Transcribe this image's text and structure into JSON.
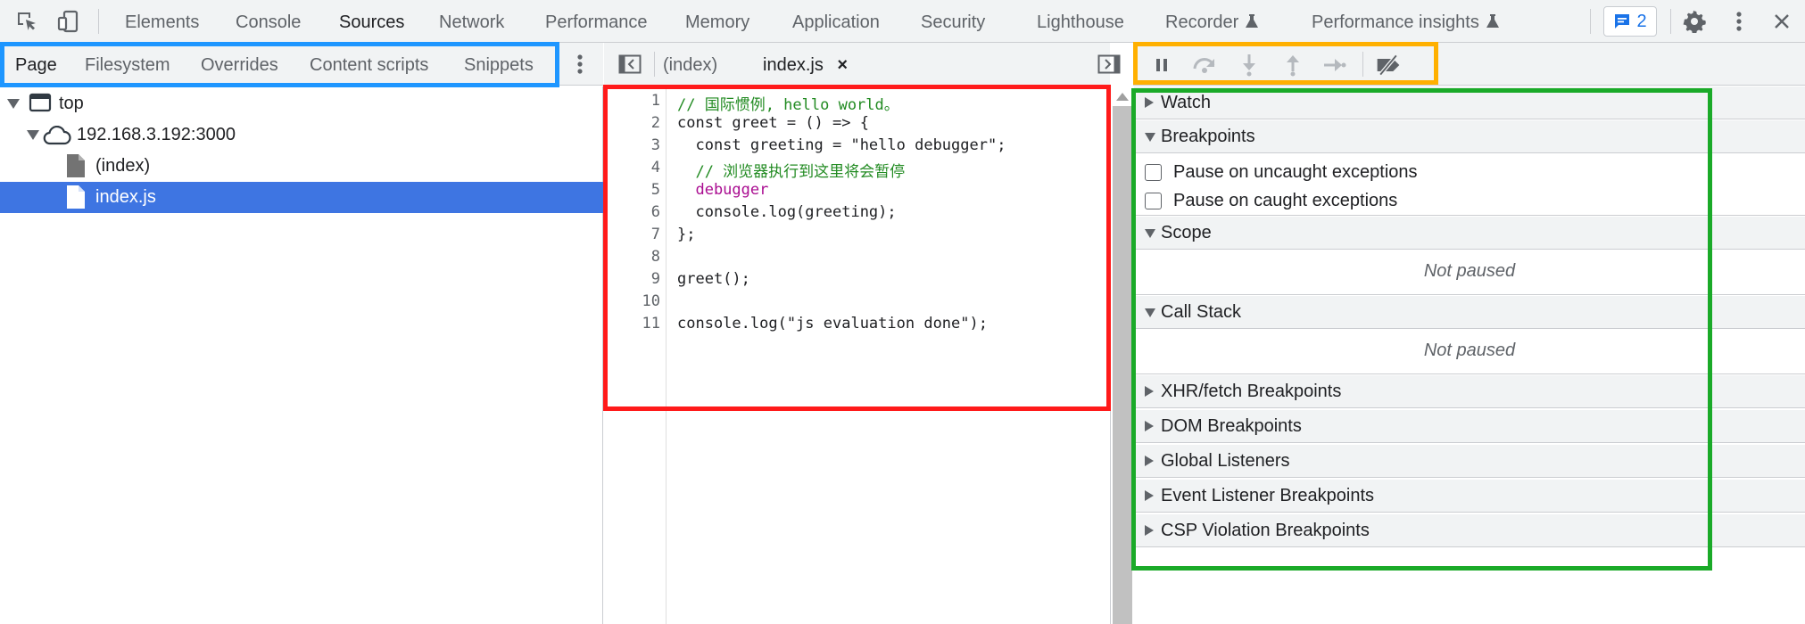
{
  "toolbar": {
    "tabs": [
      "Elements",
      "Console",
      "Sources",
      "Network",
      "Performance",
      "Memory",
      "Application",
      "Security",
      "Lighthouse",
      "Recorder",
      "Performance insights"
    ],
    "active_tab": "Sources",
    "issues_count": "2"
  },
  "navigator": {
    "tabs": [
      "Page",
      "Filesystem",
      "Overrides",
      "Content scripts",
      "Snippets"
    ],
    "active_tab": "Page",
    "tree": [
      {
        "label": "top",
        "icon": "frame-icon",
        "level": 0
      },
      {
        "label": "192.168.3.192:3000",
        "icon": "cloud-icon",
        "level": 1
      },
      {
        "label": "(index)",
        "icon": "file-icon",
        "level": 2
      },
      {
        "label": "index.js",
        "icon": "js-file-icon",
        "level": 2,
        "selected": true
      }
    ]
  },
  "editor": {
    "tabs": [
      "(index)",
      "index.js"
    ],
    "active_tab": "index.js",
    "close_symbol": "×",
    "line_numbers": [
      "1",
      "2",
      "3",
      "4",
      "5",
      "6",
      "7",
      "8",
      "9",
      "10",
      "11"
    ],
    "lines": [
      "// 国际惯例, hello world。",
      "const greet = () => {",
      "  const greeting = \"hello debugger\";",
      "  // 浏览器执行到这里将会暂停",
      "  debugger",
      "  console.log(greeting);",
      "};",
      "",
      "greet();",
      "",
      "console.log(\"js evaluation done\");"
    ]
  },
  "debugger": {
    "sections": {
      "watch": "Watch",
      "breakpoints": "Breakpoints",
      "scope": "Scope",
      "call_stack": "Call Stack",
      "xhr": "XHR/fetch Breakpoints",
      "dom": "DOM Breakpoints",
      "global": "Global Listeners",
      "event": "Event Listener Breakpoints",
      "csp": "CSP Violation Breakpoints"
    },
    "pause_uncaught": "Pause on uncaught exceptions",
    "pause_caught": "Pause on caught exceptions",
    "scope_status": "Not paused",
    "callstack_status": "Not paused"
  },
  "colors": {
    "selection": "#3e75e2",
    "annotation_blue": "#1e96ff",
    "annotation_red": "#ff1a1a",
    "annotation_orange": "#ffb000",
    "annotation_green": "#1aaa28"
  }
}
